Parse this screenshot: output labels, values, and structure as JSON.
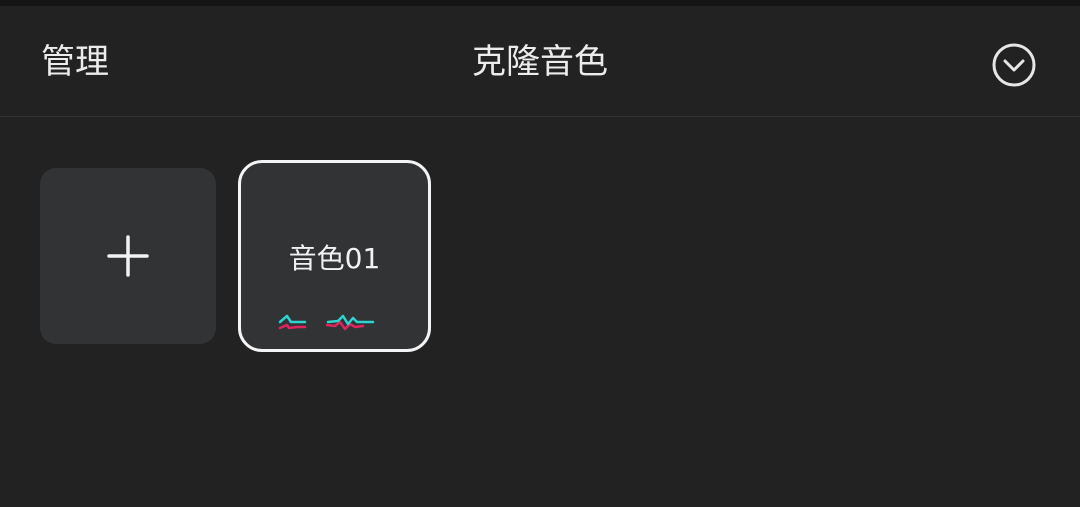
{
  "header": {
    "manage_label": "管理",
    "title": "克隆音色",
    "collapse_icon": "chevron-down-circle-icon"
  },
  "voices": {
    "add_icon": "plus-icon",
    "items": [
      {
        "name": "音色01",
        "icon": "waveform-icon"
      }
    ]
  },
  "colors": {
    "background": "#222222",
    "tile": "#313335",
    "selected_border": "#f4f4f4",
    "wave_cyan": "#2fd3d0",
    "wave_red": "#e0245e"
  }
}
